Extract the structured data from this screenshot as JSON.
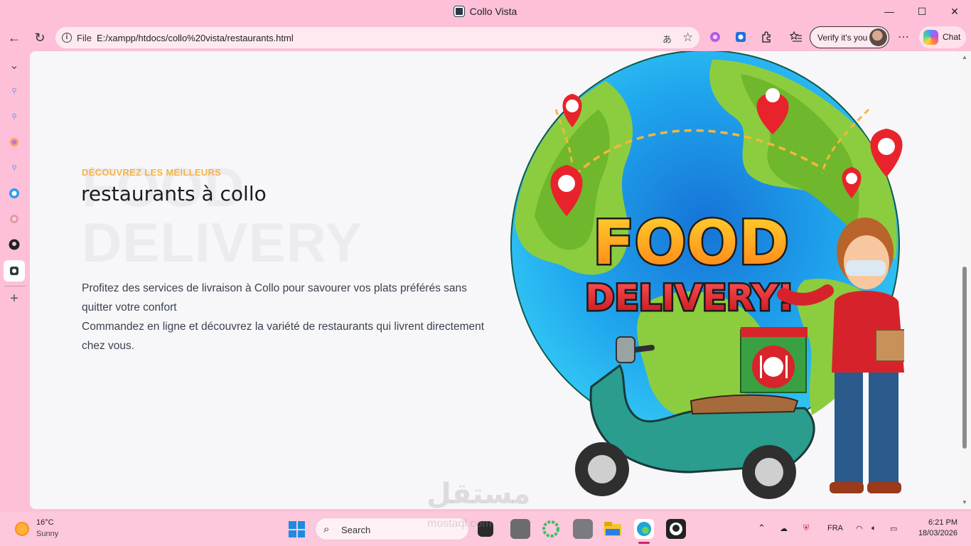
{
  "window": {
    "title": "Collo Vista",
    "controls": {
      "minimize": "—",
      "maximize": "☐",
      "close": "✕"
    }
  },
  "toolbar": {
    "back_icon": "←",
    "refresh_icon": "↻",
    "file_label": "File",
    "url": "E:/xampp/htdocs/collo%20vista/restaurants.html",
    "translate_icon": "あ",
    "favorite_icon": "☆",
    "verify_label": "Verify it's you",
    "more_icon": "⋯",
    "chat_label": "Chat"
  },
  "sidebar": {
    "items": [
      {
        "name": "collapse",
        "glyph": "⌄"
      },
      {
        "name": "search-1",
        "glyph": "🔍︎"
      },
      {
        "name": "search-2",
        "glyph": "🔍︎"
      },
      {
        "name": "app-1",
        "glyph": "✦"
      },
      {
        "name": "search-3",
        "glyph": "🔍︎"
      },
      {
        "name": "app-2",
        "glyph": "◉"
      },
      {
        "name": "app-3",
        "glyph": "❀"
      },
      {
        "name": "github",
        "glyph": "●"
      },
      {
        "name": "collo-vista",
        "glyph": "◆"
      },
      {
        "name": "add",
        "glyph": "+"
      }
    ]
  },
  "page": {
    "background_text_1": "FOOD",
    "background_text_2": "DELIVERY",
    "eyebrow": "DÉCOUVREZ LES MEILLEURS",
    "heading": "restaurants à collo",
    "paragraph_line_1": "Profitez des services de livraison à Collo pour savourer vos plats préférés sans quitter votre confort",
    "paragraph_line_2": "Commandez en ligne et découvrez la variété de restaurants qui livrent directement chez vous.",
    "illustration": {
      "title_line_1": "FOOD",
      "title_line_2": "DELIVERY!"
    },
    "accent_color": "#f3b34a"
  },
  "taskbar": {
    "weather_temp": "16°C",
    "weather_desc": "Sunny",
    "search_label": "Search",
    "tray_lang": "FRA",
    "time": "6:21 PM",
    "date": "18/03/2026"
  },
  "watermark": {
    "arabic": "مستقل",
    "latin": "mostaql.com"
  }
}
